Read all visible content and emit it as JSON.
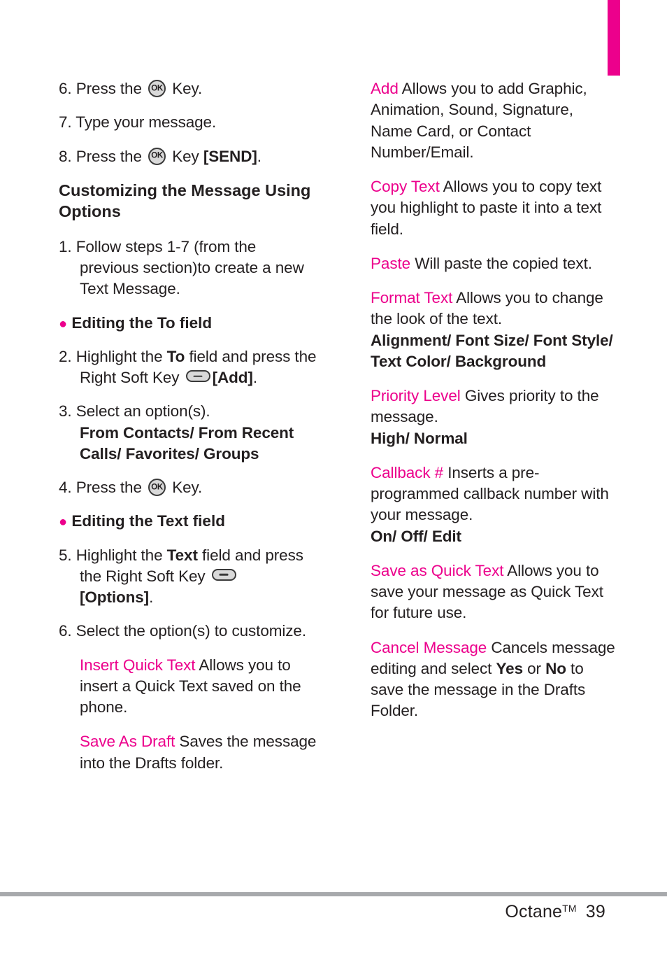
{
  "meta": {
    "accent_magenta": "#ec008c",
    "text_color": "#231f20",
    "rule_color": "#a7a9ac"
  },
  "footer": {
    "product": "Octane",
    "trademark": "TM",
    "page_number": "39"
  },
  "left_column": {
    "step6": {
      "num": "6.",
      "before_key": "Press the",
      "after_key": "Key."
    },
    "step7": {
      "text": "7.  Type your message."
    },
    "step8": {
      "num": "8.",
      "before_key": "Press the",
      "after_key": "Key",
      "bracket": "[SEND]",
      "period": "."
    },
    "section_heading": "Customizing the Message Using Options",
    "step1": {
      "num": "1.",
      "text": "Follow steps 1-7 (from the previous section)to create a new Text Message."
    },
    "bullet_to": "Editing the To field",
    "step2": {
      "num": "2.",
      "part1": "Highlight the ",
      "bold1": "To",
      "part2": " field and press the Right Soft Key",
      "bracket": "[Add]",
      "period": "."
    },
    "step3": {
      "num": "3.",
      "text": "Select an option(s).",
      "values": "From Contacts/ From Recent Calls/ Favorites/ Groups"
    },
    "step4": {
      "num": "4.",
      "before_key": "Press the",
      "after_key": "Key."
    },
    "bullet_text": "Editing the Text field",
    "step5": {
      "num": "5.",
      "part1": "Highlight the ",
      "bold1": "Text",
      "part2": " field and press the Right Soft Key",
      "bracket": "[Options]",
      "period": "."
    },
    "step6b": {
      "num": "6.",
      "text": "Select the option(s) to customize."
    },
    "options": [
      {
        "term": "Insert Quick Text",
        "description": "Allows you to insert a Quick Text saved on the phone."
      },
      {
        "term": "Save As Draft",
        "description": "Saves the message into the Drafts folder."
      }
    ]
  },
  "right_column": {
    "options": [
      {
        "term": "Add",
        "description": "Allows you to add Graphic, Animation, Sound, Signature, Name Card, or Contact Number/Email.",
        "values": ""
      },
      {
        "term": "Copy Text",
        "description": "Allows you to copy text you highlight to paste it into a text field.",
        "values": ""
      },
      {
        "term": "Paste",
        "description": "Will paste the copied text.",
        "values": ""
      },
      {
        "term": "Format Text",
        "description": "Allows you to change the look of the text.",
        "values": "Alignment/ Font Size/ Font Style/ Text Color/ Background"
      },
      {
        "term": "Priority Level",
        "description": "Gives priority to the message.",
        "values": "High/ Normal"
      },
      {
        "term": "Callback #",
        "description": "Inserts a pre-programmed callback number with your message.",
        "values": "On/ Off/ Edit"
      },
      {
        "term": "Save as Quick Text",
        "description": "Allows you to save your message as Quick Text for future use.",
        "values": ""
      }
    ],
    "cancel_message": {
      "term": "Cancel Message",
      "part1": "Cancels message editing and select ",
      "bold1": "Yes",
      "part2": " or ",
      "bold2": "No",
      "part3": " to save the message in the Drafts Folder."
    }
  }
}
